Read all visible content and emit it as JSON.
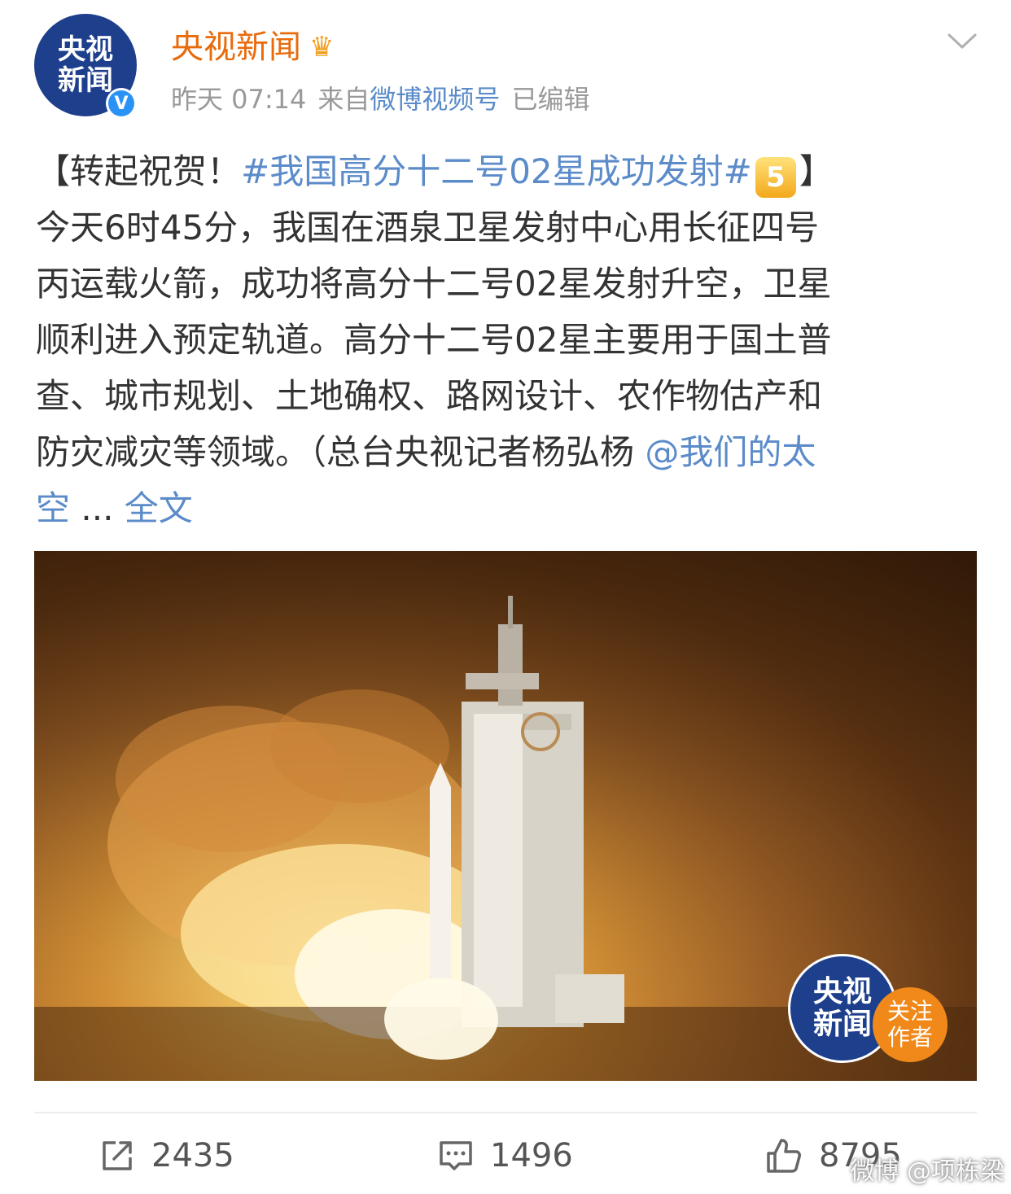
{
  "post": {
    "avatar_text_line1": "央视",
    "avatar_text_line2": "新闻",
    "avatar_at": "@",
    "verified_mark": "V",
    "username": "央视新闻",
    "crown_icon": "crown-icon",
    "time": "昨天 07:14",
    "source_prefix": "来自",
    "source": "微博视频号",
    "edited": "已编辑"
  },
  "content": {
    "bracket_open": "【转起祝贺！",
    "hashtag": "#我国高分十二号02星成功发射#",
    "badge": "5",
    "bracket_close": "】",
    "line1": "今天6时45分，我国在酒泉卫星发射中心用长征四号",
    "line2": "丙运载火箭，成功将高分十二号02星发射升空，卫星",
    "line3": "顺利进入预定轨道。高分十二号02星主要用于国土普",
    "line4": "查、城市规划、土地确权、路网设计、农作物估产和",
    "line5_text": "防灾减灾等领域。（总台央视记者杨弘杨 ",
    "mention": "@我们的太空",
    "mention_line5": "@我们的太",
    "mention_line6": "空",
    "ellipsis": " ... ",
    "full_text_link": "全文"
  },
  "media": {
    "watermark_line1": "央视",
    "watermark_line2": "新闻",
    "follow_line1": "关注",
    "follow_line2": "作者"
  },
  "actions": {
    "repost_count": "2435",
    "comment_count": "1496",
    "like_count": "8795"
  },
  "weibo_watermark": "微博 @项栋梁",
  "colors": {
    "username": "#e86b0c",
    "link": "#5b8bc9",
    "meta": "#999999",
    "text": "#333333"
  }
}
